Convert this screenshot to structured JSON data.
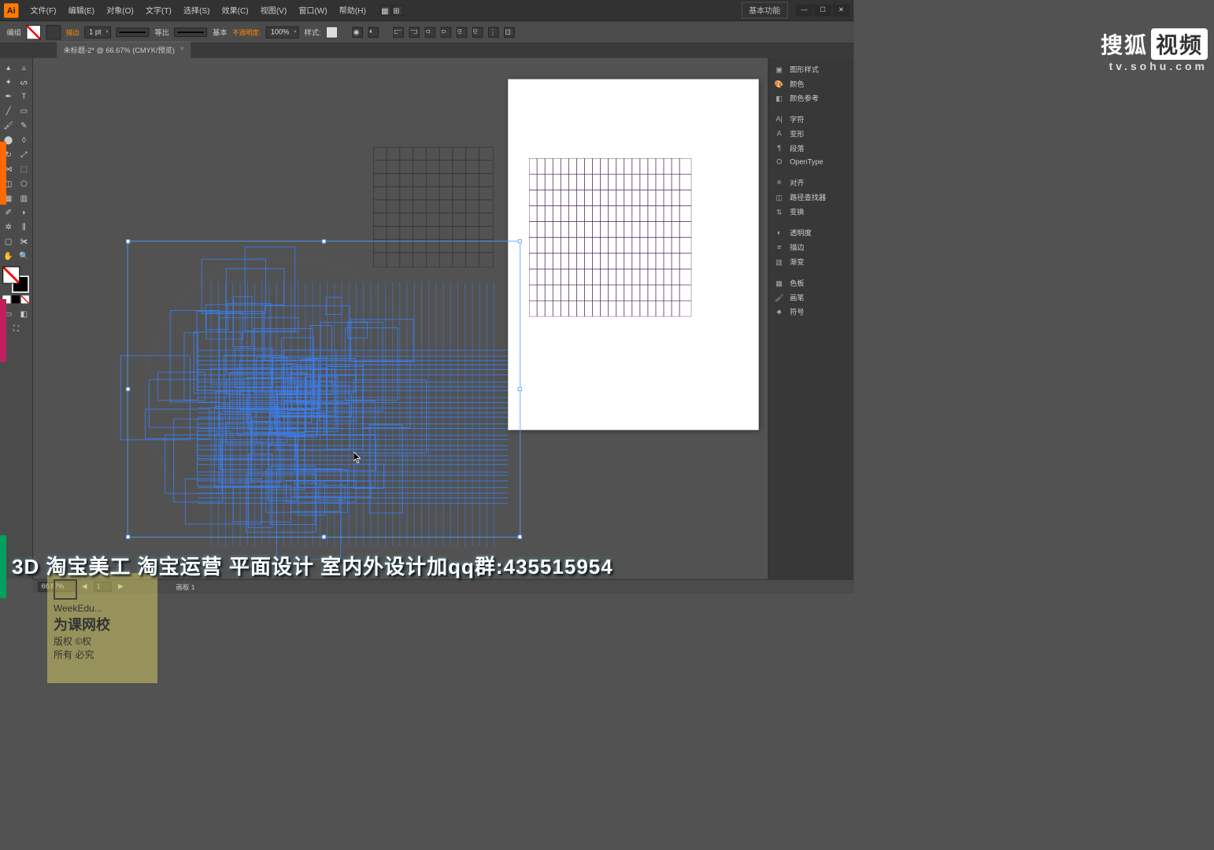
{
  "menu": {
    "items": [
      "文件(F)",
      "编辑(E)",
      "对象(O)",
      "文字(T)",
      "选择(S)",
      "效果(C)",
      "视图(V)",
      "窗口(W)",
      "帮助(H)"
    ],
    "workspace": "基本功能"
  },
  "controlbar": {
    "label_group": "编组",
    "label_stroke": "描边",
    "stroke_weight": "1 pt",
    "prof1": "等比",
    "prof2": "基本",
    "label_opacity": "不透明度:",
    "opacity": "100%",
    "label_style": "样式:"
  },
  "doc": {
    "tab": "未标题-2* @ 66.67% (CMYK/预览)"
  },
  "panels": {
    "g1": [
      "图形样式",
      "颜色",
      "颜色参考"
    ],
    "g2": [
      "字符",
      "变形",
      "段落",
      "OpenType"
    ],
    "g3": [
      "对齐",
      "路径查找器",
      "变换"
    ],
    "g4": [
      "透明度",
      "描边",
      "渐变"
    ],
    "g5": [
      "色板",
      "画笔",
      "符号"
    ]
  },
  "status": {
    "zoom": "66.67%",
    "nav": "1",
    "artboard_lbl": "画板 1"
  },
  "overlay": "3D 淘宝美工 淘宝运营 平面设计 室内外设计加qq群:435515954",
  "watermark": {
    "l1": "WeekEdu...",
    "l2": "为课网校",
    "l3": "版权 ©权",
    "l4": "所有 必究"
  },
  "sohu": {
    "brand": "搜狐",
    "badge": "视频",
    "url": "tv.sohu.com"
  }
}
